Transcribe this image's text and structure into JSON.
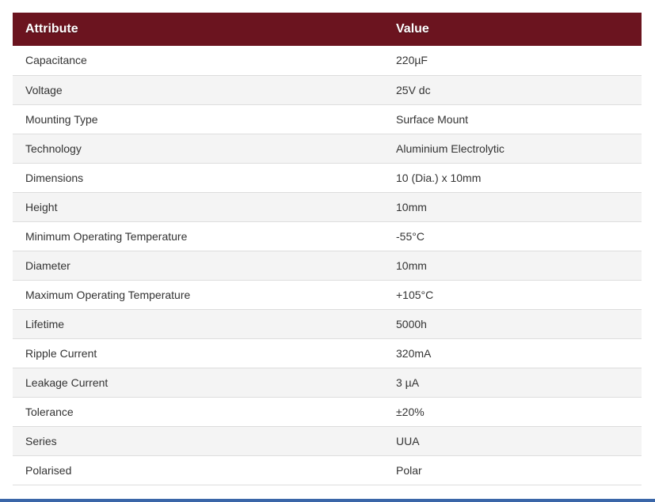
{
  "table": {
    "header": {
      "attribute": "Attribute",
      "value": "Value"
    },
    "rows": [
      {
        "attribute": "Capacitance",
        "value": "220µF"
      },
      {
        "attribute": "Voltage",
        "value": "25V dc"
      },
      {
        "attribute": "Mounting Type",
        "value": "Surface Mount"
      },
      {
        "attribute": "Technology",
        "value": "Aluminium Electrolytic"
      },
      {
        "attribute": "Dimensions",
        "value": "10 (Dia.) x 10mm"
      },
      {
        "attribute": "Height",
        "value": "10mm"
      },
      {
        "attribute": "Minimum Operating Temperature",
        "value": "-55°C"
      },
      {
        "attribute": "Diameter",
        "value": "10mm"
      },
      {
        "attribute": "Maximum Operating Temperature",
        "value": "+105°C"
      },
      {
        "attribute": "Lifetime",
        "value": "5000h"
      },
      {
        "attribute": "Ripple Current",
        "value": "320mA"
      },
      {
        "attribute": "Leakage Current",
        "value": "3 µA"
      },
      {
        "attribute": "Tolerance",
        "value": "±20%"
      },
      {
        "attribute": "Series",
        "value": "UUA"
      },
      {
        "attribute": "Polarised",
        "value": "Polar"
      }
    ]
  },
  "colors": {
    "header_background": "#6b141f",
    "header_text": "#ffffff",
    "row_alt_background": "#f4f4f4",
    "bottom_bar": "#3a66a8"
  }
}
